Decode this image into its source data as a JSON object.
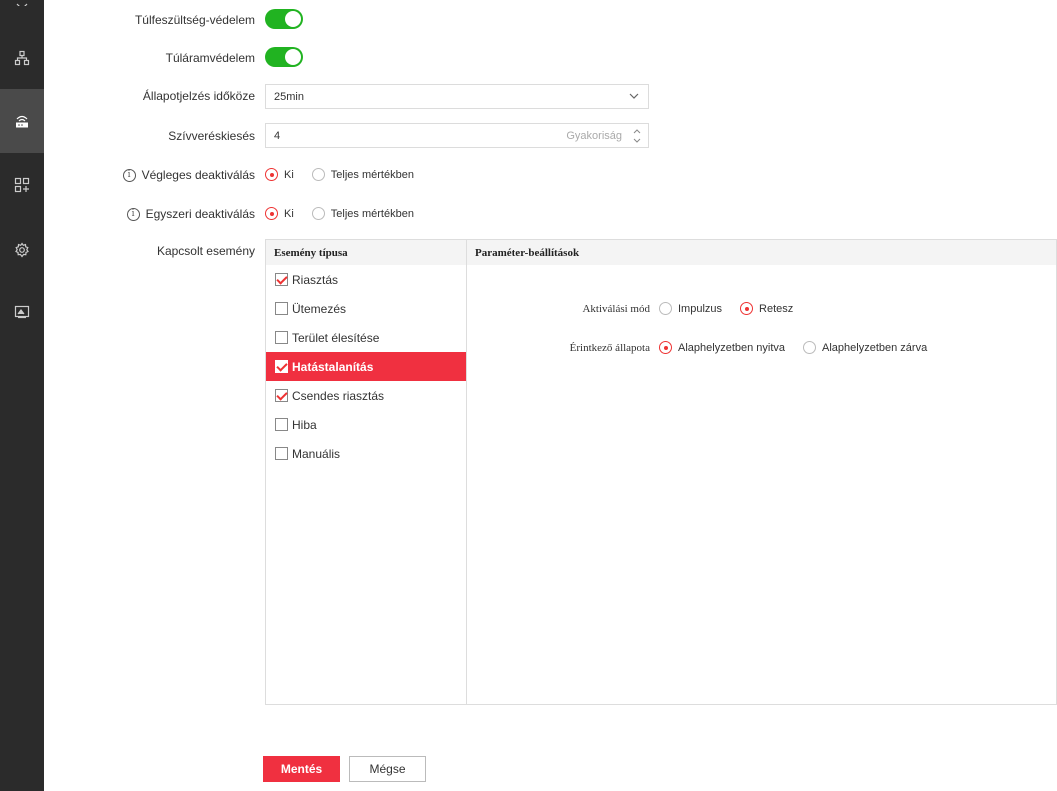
{
  "sidebar": {
    "items": [
      {
        "icon": "network-topology-icon"
      },
      {
        "icon": "device-icon",
        "active": true
      },
      {
        "icon": "modules-icon"
      },
      {
        "icon": "gear-icon"
      },
      {
        "icon": "image-icon"
      }
    ]
  },
  "form": {
    "overvoltage_label": "Túlfeszültség-védelem",
    "overcurrent_label": "Túláramvédelem",
    "status_interval_label": "Állapotjelzés időköze",
    "status_interval_value": "25min",
    "heartbeat_label": "Szívveréskiesés",
    "heartbeat_value": "4",
    "heartbeat_suffix": "Gyakoriság",
    "permanent_deact_label": "Végleges deaktiválás",
    "single_deact_label": "Egyszeri deaktiválás",
    "option_off": "Ki",
    "option_full": "Teljes mértékben",
    "linked_event_label": "Kapcsolt esemény"
  },
  "events": {
    "type_header": "Esemény típusa",
    "param_header": "Paraméter-beállítások",
    "items": [
      {
        "label": "Riasztás",
        "checked": true
      },
      {
        "label": "Ütemezés",
        "checked": false
      },
      {
        "label": "Terület élesítése",
        "checked": false
      },
      {
        "label": "Hatástalanítás",
        "checked": true
      },
      {
        "label": "Csendes riasztás",
        "checked": true
      },
      {
        "label": "Hiba",
        "checked": false
      },
      {
        "label": "Manuális",
        "checked": false
      }
    ]
  },
  "params": {
    "activation_mode_label": "Aktiválási mód",
    "impulse": "Impulzus",
    "latch": "Retesz",
    "contact_state_label": "Érintkező állapota",
    "normally_open": "Alaphelyzetben nyitva",
    "normally_closed": "Alaphelyzetben zárva"
  },
  "buttons": {
    "save": "Mentés",
    "cancel": "Mégse"
  },
  "colors": {
    "accent": "#f03040",
    "toggle_on": "#21b321",
    "sidebar": "#2b2b2b"
  }
}
